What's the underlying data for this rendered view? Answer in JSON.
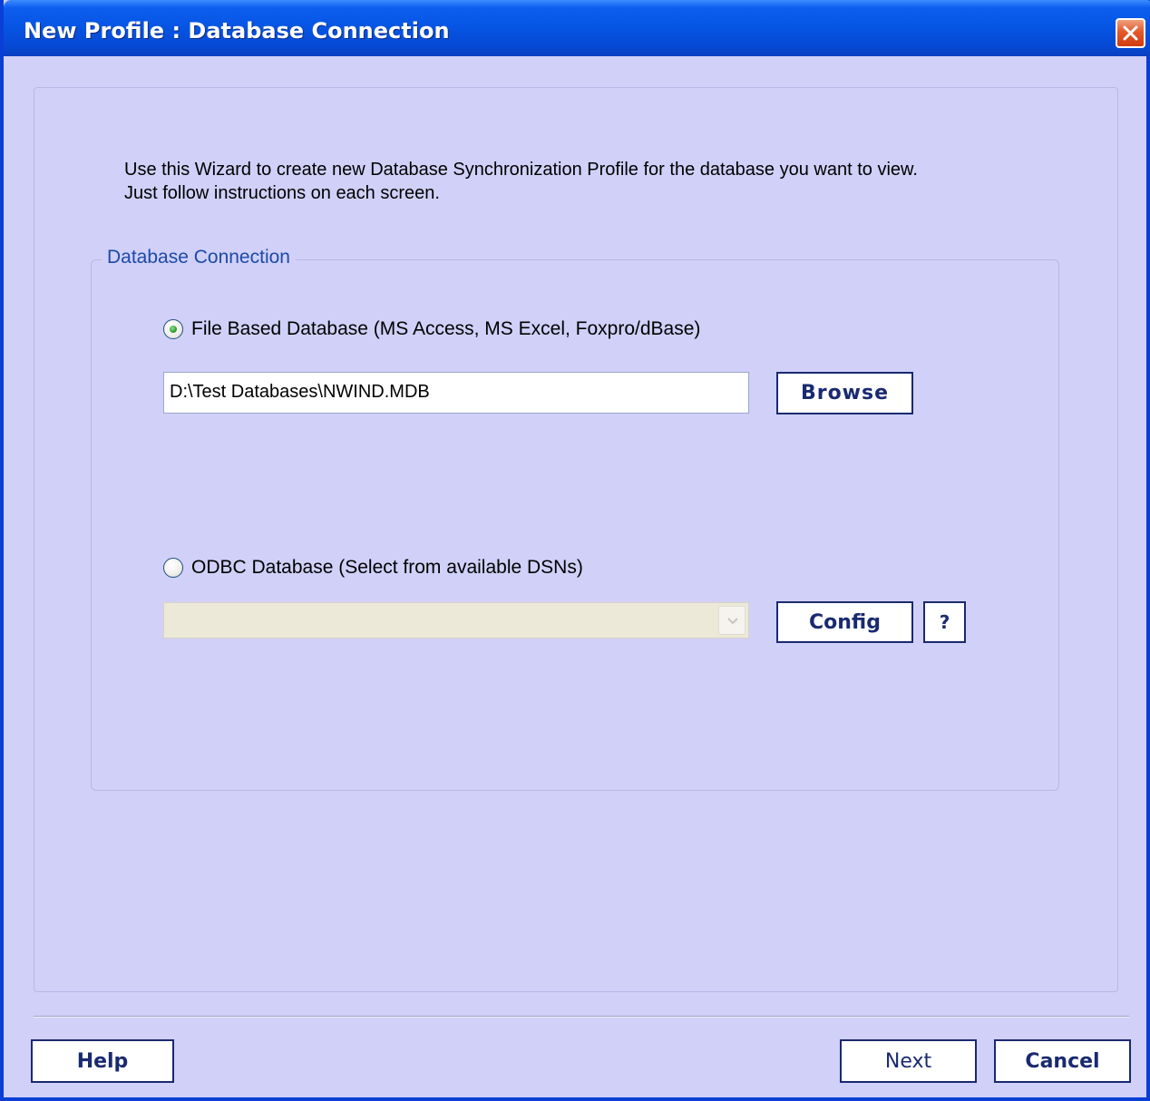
{
  "window": {
    "title": "New Profile : Database Connection"
  },
  "intro": {
    "line1": "Use this Wizard to create new Database Synchronization Profile for the database you want to view.",
    "line2": "Just follow instructions on each screen."
  },
  "group": {
    "legend": "Database Connection",
    "file_option": {
      "label": "File Based Database (MS Access, MS Excel, Foxpro/dBase)",
      "checked": true,
      "path_value": "D:\\Test Databases\\NWIND.MDB",
      "browse_label": "Browse"
    },
    "odbc_option": {
      "label": "ODBC Database (Select from available DSNs)",
      "checked": false,
      "selected_dsn": "",
      "config_label": "Config",
      "help_label": "?"
    }
  },
  "footer": {
    "help_label": "Help",
    "next_label": "Next",
    "cancel_label": "Cancel"
  },
  "colors": {
    "titlebar": "#0654e2",
    "background": "#d0d0f8",
    "button_text": "#1a2a70",
    "legend_text": "#1c4aa8"
  },
  "icons": {
    "close": "close-x-icon",
    "combo_arrow": "chevron-down-icon"
  }
}
